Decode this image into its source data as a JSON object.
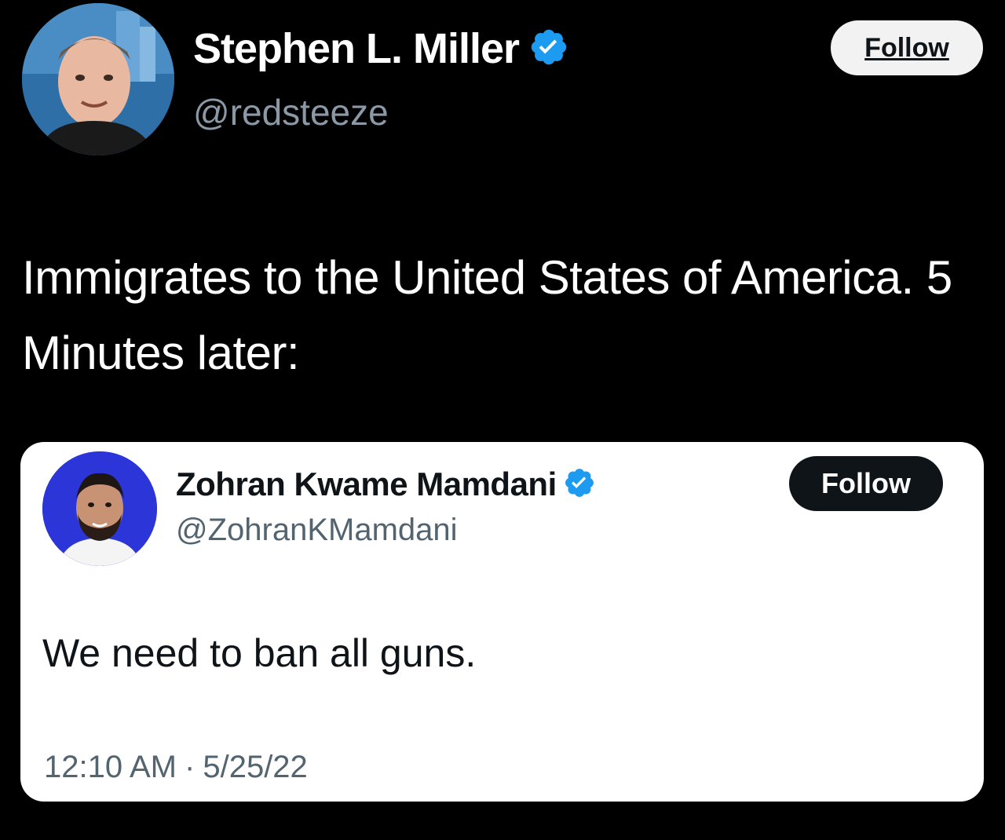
{
  "outer_tweet": {
    "author_name": "Stephen L. Miller",
    "author_handle": "@redsteeze",
    "verified": true,
    "follow_label": "Follow",
    "text": "Immigrates to the United States of America. 5 Minutes later:"
  },
  "quoted_tweet": {
    "author_name": "Zohran Kwame Mamdani",
    "author_handle": "@ZohranKMamdani",
    "verified": true,
    "follow_label": "Follow",
    "text": "We need to ban all guns.",
    "time": "12:10 AM",
    "separator": "·",
    "date": "5/25/22"
  },
  "icons": {
    "verified": "verified-badge-icon",
    "avatar_outer": "avatar",
    "avatar_inner": "avatar"
  },
  "colors": {
    "background": "#000000",
    "verified_blue": "#1d9bf0",
    "handle_gray_dark": "#8b98a5",
    "handle_gray_light": "#536471",
    "card_background": "#ffffff"
  }
}
